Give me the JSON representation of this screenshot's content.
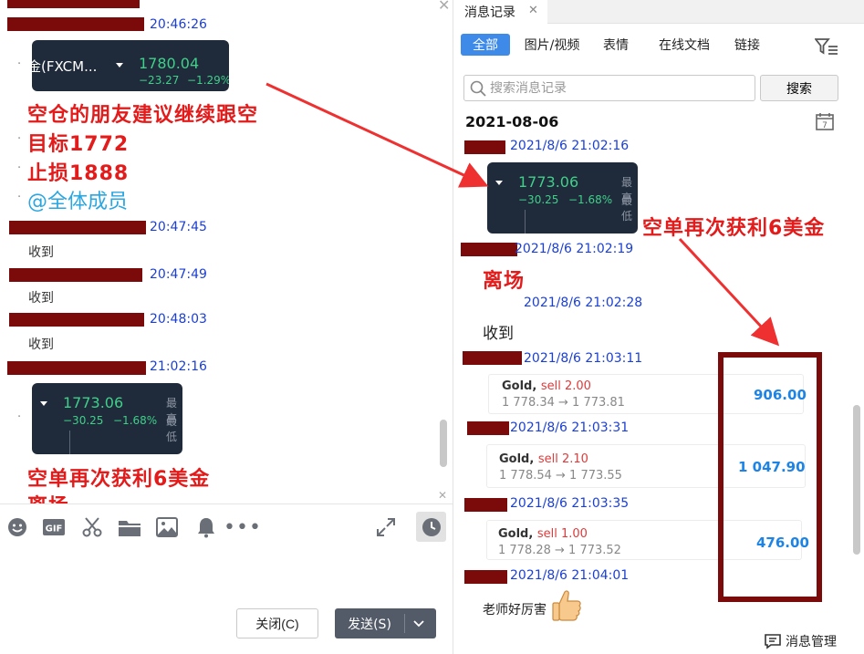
{
  "chat": {
    "messages": [
      {
        "time": "20:46:26"
      },
      {
        "time": "20:47:45",
        "text": "收到"
      },
      {
        "time": "20:47:49",
        "text": "收到"
      },
      {
        "time": "20:48:03",
        "text": "收到"
      },
      {
        "time": "21:02:16"
      }
    ],
    "quote_top": {
      "name": "金(FXCM...",
      "price": "1780.04",
      "change": "−23.27",
      "change_pct": "−1.29%"
    },
    "quote_mid": {
      "price": "1773.06",
      "change": "−30.25",
      "change_pct": "−1.68%",
      "side_top": "最高",
      "side_bottom": "最低"
    },
    "annotations": [
      "空仓的朋友建议继续跟空",
      "目标1772",
      "止损1888"
    ],
    "mention": "@全体成员",
    "bottom_annotation_1": "空单再次获利6美金",
    "bottom_annotation_2": "离场",
    "close_button": "关闭(C)",
    "send_button": "发送(S)"
  },
  "history": {
    "tab_title": "消息记录",
    "filters": [
      "全部",
      "图片/视频",
      "表情",
      "在线文档",
      "链接"
    ],
    "search_placeholder": "搜索消息记录",
    "search_button": "搜索",
    "date": "2021-08-06",
    "calendar_day": "7",
    "entries": [
      {
        "time": "2021/8/6 21:02:16"
      },
      {
        "time": "2021/8/6 21:02:19",
        "text": "离场"
      },
      {
        "time": "2021/8/6 21:02:28",
        "text": "收到"
      },
      {
        "time": "2021/8/6 21:03:11"
      },
      {
        "time": "2021/8/6 21:03:31"
      },
      {
        "time": "2021/8/6 21:03:35"
      },
      {
        "time": "2021/8/6 21:04:01",
        "text": "老师好厉害"
      }
    ],
    "quote": {
      "price": "1773.06",
      "change": "−30.25",
      "change_pct": "−1.68%",
      "side_top": "最高",
      "side_bottom": "最低"
    },
    "trades": [
      {
        "symbol": "Gold,",
        "action": "sell 2.00",
        "range": "1 778.34 → 1 773.81",
        "profit": "906.00"
      },
      {
        "symbol": "Gold,",
        "action": "sell 2.10",
        "range": "1 778.54 → 1 773.55",
        "profit": "1 047.90"
      },
      {
        "symbol": "Gold,",
        "action": "sell 1.00",
        "range": "1 778.28 → 1 773.52",
        "profit": "476.00"
      }
    ],
    "annotation": "空单再次获利6美金",
    "manage_label": "消息管理"
  },
  "colors": {
    "accent": "#3d8ae8",
    "timestamp": "#1a3fd6",
    "annotation": "#e31b1b",
    "redact": "#7b0a0a",
    "profit": "#1d84e6",
    "quote_green": "#3fd08a"
  }
}
